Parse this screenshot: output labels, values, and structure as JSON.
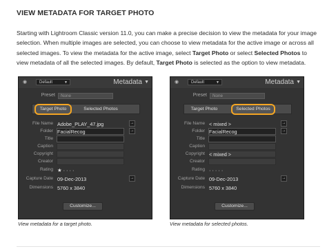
{
  "heading": "VIEW METADATA FOR TARGET PHOTO",
  "paragraph": {
    "p1": "Starting with Lightroom Classic version 11.0, you can make a precise decision to view the metadata for your image selection. When multiple images are selected, you can choose to view metadata for the active image or across all selected images. To view the metadata for the active image, select ",
    "b1": "Target Photo",
    "p2": " or select ",
    "b2": "Selected Photos",
    "p3": " to view metadata of all the selected images. By default, ",
    "b3": "Target Photo",
    "p4": " is selected as the option to view metadata."
  },
  "panels": [
    {
      "header_preset": "Default",
      "title": "Metadata",
      "preset_label": "Preset",
      "preset_value": "None",
      "tab_target": "Target Photo",
      "tab_selected": "Selected Photos",
      "selected_tab": "target",
      "rows": [
        {
          "label": "File Name",
          "value": "Adobe_PLAY_47.jpg",
          "button": true
        },
        {
          "label": "Folder",
          "value": "FacialRecog",
          "button": true
        },
        {
          "label": "Title",
          "value": ""
        },
        {
          "label": "Caption",
          "value": ""
        },
        {
          "label": "Copyright",
          "value": ""
        },
        {
          "label": "Creator",
          "value": ""
        },
        {
          "label": "Rating",
          "value": "★ · · · ·"
        },
        {
          "label": "Capture Date",
          "value": "09-Dec-2013",
          "button": true
        },
        {
          "label": "Dimensions",
          "value": "5760 x 3840"
        }
      ],
      "customize": "Customize...",
      "caption": "View metadata for a target photo."
    },
    {
      "header_preset": "Default",
      "title": "Metadata",
      "preset_label": "Preset",
      "preset_value": "None",
      "tab_target": "Target Photo",
      "tab_selected": "Selected Photos",
      "selected_tab": "selected",
      "rows": [
        {
          "label": "File Name",
          "value": "< mixed >",
          "button": true
        },
        {
          "label": "Folder",
          "value": "FacialRecog",
          "button": true
        },
        {
          "label": "Title",
          "value": ""
        },
        {
          "label": "Caption",
          "value": ""
        },
        {
          "label": "Copyright",
          "value": "< mixed >"
        },
        {
          "label": "Creator",
          "value": ""
        },
        {
          "label": "Rating",
          "value": "· · · · ·"
        },
        {
          "label": "Capture Date",
          "value": "09-Dec-2013",
          "button": true
        },
        {
          "label": "Dimensions",
          "value": "5760 x 3840"
        }
      ],
      "customize": "Customize...",
      "caption": "View metadata for selected photos."
    }
  ],
  "colors": {
    "accent": "#f5a623",
    "panel_bg": "#333333"
  }
}
